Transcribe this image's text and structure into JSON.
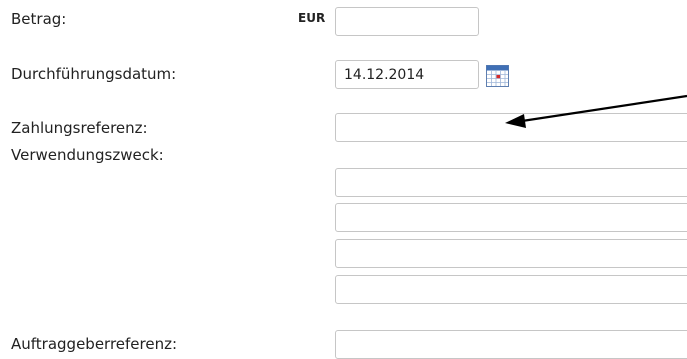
{
  "form": {
    "amount": {
      "label": "Betrag:",
      "currency": "EUR",
      "value": ""
    },
    "execution_date": {
      "label": "Durchführungsdatum:",
      "value": "14.12.2014",
      "calendar_icon": "calendar-icon"
    },
    "payment_reference": {
      "label": "Zahlungsreferenz:",
      "value": ""
    },
    "purpose": {
      "label": "Verwendungszweck:",
      "lines": [
        "",
        "",
        "",
        ""
      ]
    },
    "originator_reference": {
      "label": "Auftraggeberreferenz:",
      "value": ""
    }
  },
  "annotation": {
    "icon": "arrow-icon",
    "color": "#000000"
  }
}
